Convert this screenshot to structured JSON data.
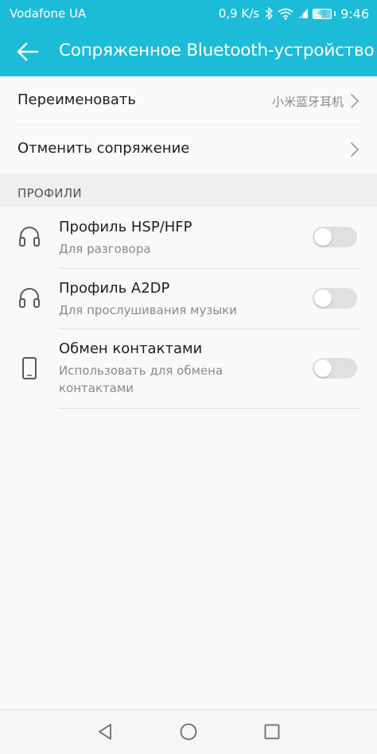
{
  "status_bar": {
    "carrier": "Vodafone UA",
    "speed": "0,9 K/s",
    "network": "46",
    "time": "9:46",
    "icons": [
      "bluetooth-icon",
      "wifi-icon",
      "signal-icon",
      "battery-icon"
    ]
  },
  "app_bar": {
    "title": "Сопряженное Bluetooth-устройство",
    "back_icon": "arrow-left-icon"
  },
  "menu": {
    "rename": {
      "label": "Переименовать",
      "value": "小米蓝牙耳机"
    },
    "unpair": {
      "label": "Отменить сопряжение"
    }
  },
  "profiles": {
    "header": "ПРОФИЛИ",
    "items": [
      {
        "title": "Профиль HSP/HFP",
        "subtitle": "Для разговора",
        "icon": "headphones-icon",
        "enabled": false
      },
      {
        "title": "Профиль A2DP",
        "subtitle": "Для прослушивания музыки",
        "icon": "headphones-icon",
        "enabled": false
      },
      {
        "title": "Обмен контактами",
        "subtitle": "Использовать для обмена контактами",
        "icon": "phone-icon",
        "enabled": false
      }
    ]
  },
  "nav_bar": {
    "buttons": [
      "back-triangle-icon",
      "home-circle-icon",
      "recents-square-icon"
    ]
  },
  "colors": {
    "accent": "#1cbcd8",
    "background": "#f9f9f9",
    "section_header_bg": "#efefef",
    "toggle_off": "#e0e0e0"
  }
}
